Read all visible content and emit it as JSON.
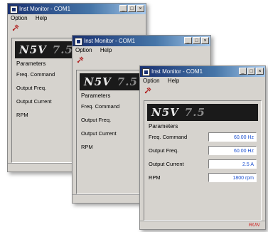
{
  "windows": [
    {
      "title": "Inst Monitor - COM1",
      "menu": [
        "Option",
        "Help"
      ],
      "logo": "N5V",
      "model": "7.5",
      "group_title": "Parameters",
      "rows": [
        {
          "label": "Freq. Command",
          "value": ""
        },
        {
          "label": "Output Freq.",
          "value": ""
        },
        {
          "label": "Output Current",
          "value": ""
        },
        {
          "label": "RPM",
          "value": ""
        }
      ],
      "status": ""
    },
    {
      "title": "Inst Monitor - COM1",
      "menu": [
        "Option",
        "Help"
      ],
      "logo": "N5V",
      "model": "7.5",
      "group_title": "Parameters",
      "rows": [
        {
          "label": "Freq. Command",
          "value": ""
        },
        {
          "label": "Output Freq.",
          "value": ""
        },
        {
          "label": "Output Current",
          "value": ""
        },
        {
          "label": "RPM",
          "value": ""
        }
      ],
      "status": ""
    },
    {
      "title": "Inst Monitor - COM1",
      "menu": [
        "Option",
        "Help"
      ],
      "logo": "N5V",
      "model": "7.5",
      "group_title": "Parameters",
      "rows": [
        {
          "label": "Freq. Command",
          "value": "60.00 Hz"
        },
        {
          "label": "Output Freq.",
          "value": "60.00 Hz"
        },
        {
          "label": "Output Current",
          "value": "2.5 A"
        },
        {
          "label": "RPM",
          "value": "1800 rpm"
        }
      ],
      "status": "RUN"
    }
  ],
  "title_controls": [
    "_",
    "□",
    "×"
  ],
  "colors": {
    "titlebar_start": "#0a246a",
    "value_text": "#1a4fd0",
    "status_text": "#d02020"
  },
  "icons": {
    "toolbar": "connect-icon"
  }
}
